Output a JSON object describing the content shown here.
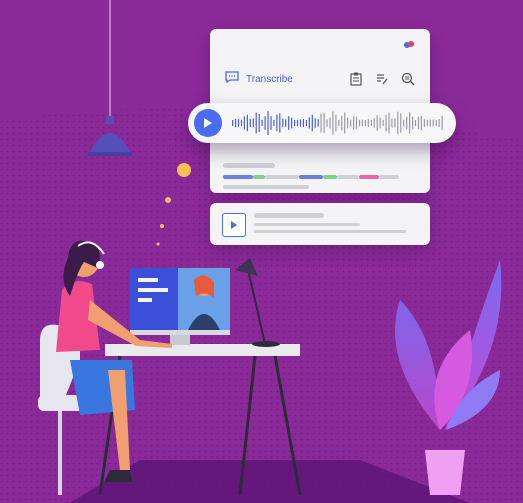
{
  "toolbar": {
    "transcribe_label": "Transcribe",
    "icons": [
      "chat-icon",
      "clipboard-icon",
      "document-edit-icon",
      "search-text-icon"
    ]
  },
  "player": {
    "icons": [
      "play-icon"
    ]
  },
  "colors": {
    "background": "#8a2a99",
    "accent": "#4a6cf0",
    "panel": "#f4f4f6"
  }
}
